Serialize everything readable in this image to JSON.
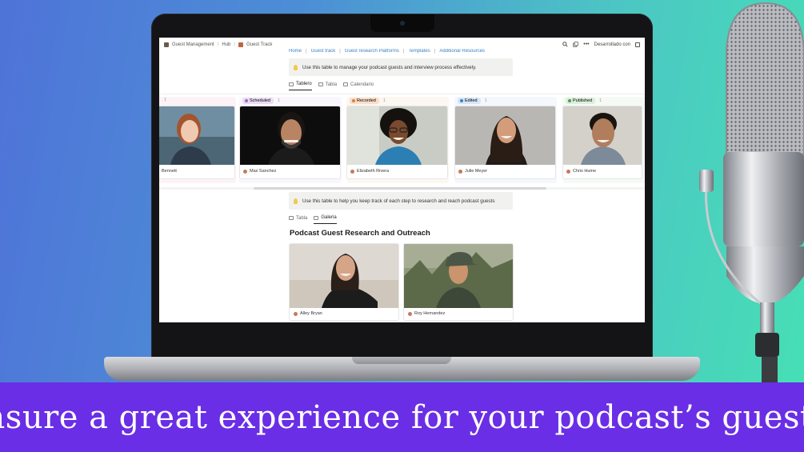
{
  "topbar": {
    "breadcrumb": [
      "Guest Management",
      "Hub",
      "Guest Track"
    ],
    "separator": "/",
    "search_icon": "search-icon",
    "share_icon": "copy-icon",
    "more_label": "•••",
    "workspace_label": "Desarrollado con"
  },
  "links": [
    "Home",
    "Guest track",
    "Guest research Platforms",
    "Templates",
    "Additional Resources"
  ],
  "link_separator": "|",
  "board_section": {
    "callout": "Use this table to manage your podcast guests and interview process effectively.",
    "views": [
      "Tablero",
      "Tabla",
      "Calendario"
    ],
    "columns": [
      {
        "status": "",
        "count": "1",
        "name": "Bennett",
        "tag_color": "#ffffff",
        "dot_color": "#e9a1b5"
      },
      {
        "status": "Scheduled",
        "count": "1",
        "name": "Max Sanchez",
        "tag_color": "#eadcf4",
        "dot_color": "#9a6dc4"
      },
      {
        "status": "Recorded",
        "count": "1",
        "name": "Elizabeth Rivera",
        "tag_color": "#fadec9",
        "dot_color": "#d9803c"
      },
      {
        "status": "Edited",
        "count": "1",
        "name": "Julie Meyer",
        "tag_color": "#d7e7f7",
        "dot_color": "#3f7fc0"
      },
      {
        "status": "Published",
        "count": "1",
        "name": "Chris Hume",
        "tag_color": "#dcefdc",
        "dot_color": "#4d9a55"
      }
    ]
  },
  "research_section": {
    "callout": "Use this table to help you keep track of each step to research and reach podcast guests",
    "views": [
      "Tabla",
      "Galeria"
    ],
    "title": "Podcast Guest Research and Outreach",
    "cards": [
      {
        "name": "Alley Bryan"
      },
      {
        "name": "Roy Hernandez"
      }
    ]
  },
  "banner": {
    "text": "Ensure a great experience for your podcast’s guests!",
    "color": "#6a2ee6"
  }
}
